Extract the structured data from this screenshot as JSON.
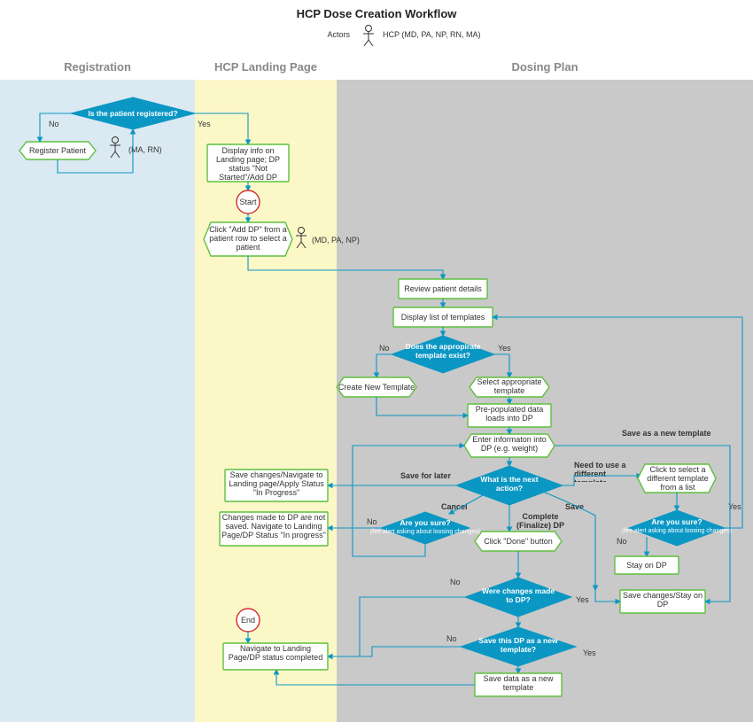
{
  "header": {
    "title": "HCP Dose Creation Workflow",
    "actors_label": "Actors",
    "actors_value": "HCP (MD, PA, NP, RN, MA)"
  },
  "lanes": {
    "registration": "Registration",
    "landing": "HCP Landing Page",
    "dosing": "Dosing Plan"
  },
  "nodes": {
    "d_registered": "Is the patient registered?",
    "register_patient": "Register Patient",
    "actor_ma_rn": "(MA, RN)",
    "display_landing": "Display info on Landing page; DP status \"Not Started\"/Add DP",
    "start": "Start",
    "click_add_dp": "Click \"Add DP\" from a patient row to select a patient",
    "actor_md_pa_np": "(MD, PA, NP)",
    "review_patient": "Review patient details",
    "display_templates": "Display list of templates",
    "d_template_exists": "Does the appropirate template exist?",
    "create_template": "Create New Template",
    "select_template": "Select appropriate template",
    "prepopulated": "Pre-populated data loads into DP",
    "enter_info": "Enter informaton into DP (e.g. weight)",
    "d_next_action": "What is the next action?",
    "save_navigate": "Save changes/Navigate to Landing page/Apply Status \"In Progress\"",
    "changes_not_saved": "Changes made to DP are not saved. Navigate to Landing Page/DP Status \"In progress\"",
    "d_sure_cancel": "Are you sure?",
    "d_sure_cancel_sub": "(fire alert asking about loosing changes)",
    "click_done": "Click \"Done\" button",
    "click_select_diff": "Click to select a different template from a list",
    "d_sure_diff": "Are you sure?",
    "d_sure_diff_sub": "(fire alert asking about loosing changes)",
    "stay_on_dp": "Stay on DP",
    "save_stay": "Save changes/Stay on DP",
    "d_changes_made": "Were changes made to DP?",
    "d_save_as_template": "Save this DP as a new template?",
    "save_data_template": "Save data as a new template",
    "end": "End",
    "navigate_completed": "Navigate to Landing Page/DP status completed"
  },
  "labels": {
    "yes": "Yes",
    "no": "No",
    "save_for_later": "Save for later",
    "cancel": "Cancel",
    "save": "Save",
    "complete": "Complete (Finalize) DP",
    "need_diff": "Need to use a different template",
    "save_as_new": "Save as a new template"
  }
}
